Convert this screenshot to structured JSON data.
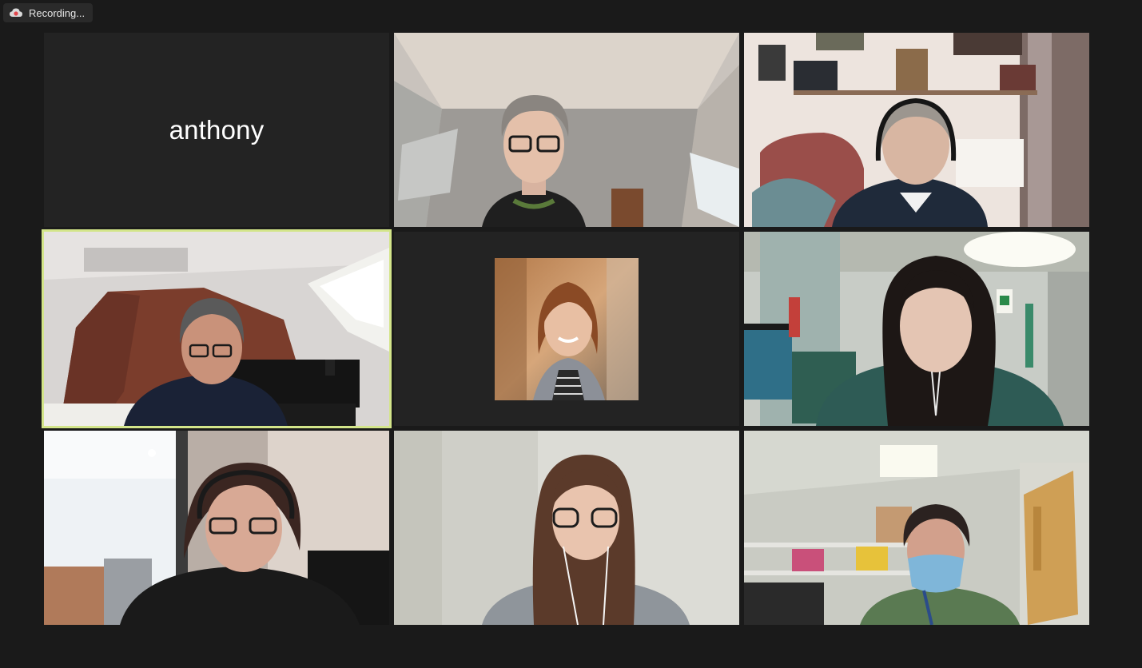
{
  "recording": {
    "label": "Recording...",
    "icon": "cloud-record-icon",
    "icon_color": "#e0464b"
  },
  "participants": [
    {
      "display": "anthony",
      "type": "name-only"
    },
    {
      "type": "video"
    },
    {
      "type": "video"
    },
    {
      "type": "video",
      "active_speaker": true,
      "highlight_color": "#d3e58a"
    },
    {
      "type": "profile-picture"
    },
    {
      "type": "video"
    },
    {
      "type": "video"
    },
    {
      "type": "video"
    },
    {
      "type": "video"
    }
  ]
}
